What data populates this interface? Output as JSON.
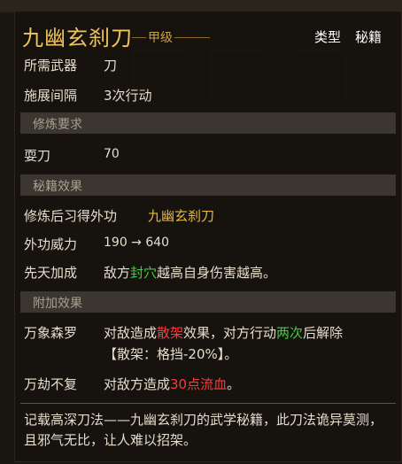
{
  "item": {
    "name": "九幽玄刹刀",
    "grade": "甲级",
    "type_label": "类型",
    "type_value": "秘籍"
  },
  "basic": {
    "weapon_key": "所需武器",
    "weapon_val": "刀",
    "interval_key": "施展间隔",
    "interval_val": "3次行动"
  },
  "requirements": {
    "header": "修炼要求",
    "skill_key": "耍刀",
    "skill_val": "70"
  },
  "effect": {
    "header": "秘籍效果",
    "learn_key": "修炼后习得外功",
    "learn_val": "九幽玄刹刀",
    "power_key": "外功威力",
    "power_val": "190 → 640",
    "first_key": "先天加成",
    "first_p1": "敌方",
    "first_hl": "封穴",
    "first_p2": "越高自身伤害越高。"
  },
  "extra": {
    "header": "附加效果",
    "e1_key": "万象森罗",
    "e1_p1": "对敌造成",
    "e1_hl1": "散架",
    "e1_p2": "效果，对方行动",
    "e1_hl2": "两次",
    "e1_p3": "后解除",
    "e1_line2": "【散架：格挡-20%】。",
    "e2_key": "万劫不复",
    "e2_p1": "对敌方造成",
    "e2_hl": "30点流血",
    "e2_p2": "。"
  },
  "description": "记载高深刀法——九幽玄刹刀的武学秘籍，此刀法诡异莫测，且邪气无比，让人难以招架。",
  "colors": {
    "gold": "#e8b840",
    "title": "#f0c45a",
    "green": "#3ed03e",
    "red": "#ff3a3a",
    "section_bg": "#3b362f"
  }
}
